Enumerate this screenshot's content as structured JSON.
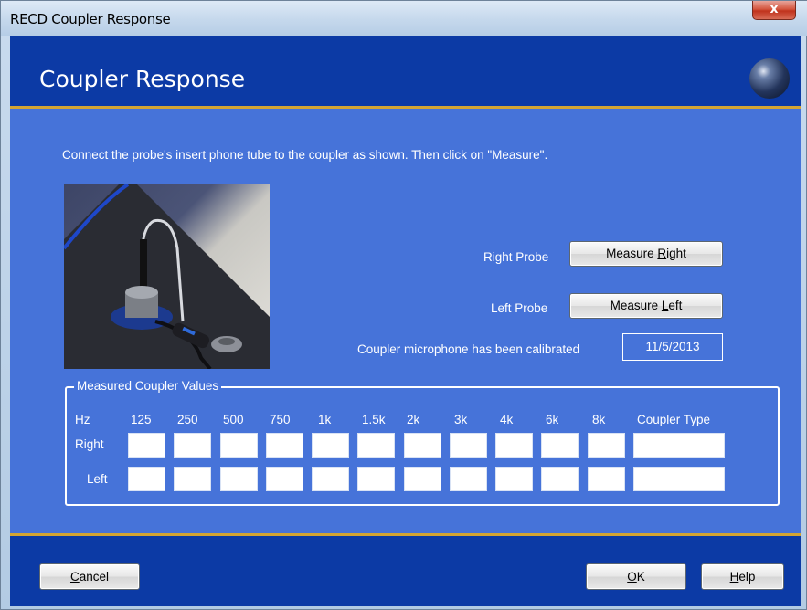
{
  "window": {
    "title": "RECD Coupler Response",
    "close_glyph": "x"
  },
  "header": {
    "title": "Coupler Response",
    "logo_icon": "sphere-logo-icon"
  },
  "instructions": "Connect the probe's insert phone tube to the coupler as shown. Then click on \"Measure\".",
  "probes": {
    "right_label": "Right Probe",
    "right_button": {
      "prefix": "Measure ",
      "key": "R",
      "suffix": "ight"
    },
    "left_label": "Left Probe",
    "left_button": {
      "prefix": "Measure ",
      "key": "L",
      "suffix": "eft"
    }
  },
  "calibration": {
    "label": "Coupler microphone has been calibrated",
    "date": "11/5/2013"
  },
  "measured": {
    "legend": "Measured Coupler Values",
    "hz_label": "Hz",
    "frequencies": [
      "125",
      "250",
      "500",
      "750",
      "1k",
      "1.5k",
      "2k",
      "3k",
      "4k",
      "6k",
      "8k"
    ],
    "coupler_type_label": "Coupler Type",
    "right_label": "Right",
    "left_label": "Left",
    "right_values": [
      "",
      "",
      "",
      "",
      "",
      "",
      "",
      "",
      "",
      "",
      ""
    ],
    "left_values": [
      "",
      "",
      "",
      "",
      "",
      "",
      "",
      "",
      "",
      "",
      ""
    ],
    "right_coupler_type": "",
    "left_coupler_type": ""
  },
  "footer": {
    "cancel": {
      "key": "C",
      "suffix": "ancel"
    },
    "ok": {
      "key": "O",
      "suffix": "K"
    },
    "help": {
      "key": "H",
      "suffix": "elp"
    }
  },
  "colors": {
    "header_blue": "#0c3aa5",
    "panel_blue": "#4673d9",
    "accent_gold": "#d4a533",
    "close_red": "#c0331d"
  }
}
